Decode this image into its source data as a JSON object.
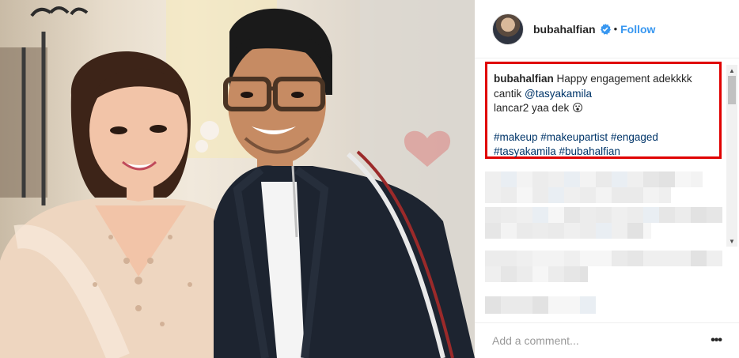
{
  "post": {
    "photo_icon": "photo-of-couple",
    "header": {
      "username": "bubahalfian",
      "verified_icon": "verified-badge-icon",
      "separator": "•",
      "follow_label": "Follow"
    },
    "caption": {
      "username": "bubahalfian",
      "line1": "Happy engagement adekkkk",
      "line2_prefix": "cantik ",
      "mention": "@tasyakamila",
      "line3": "lancar2 yaa dek 😮",
      "hashtags_line1": "#makeup #makeupartist #engaged",
      "hashtags_line2": "#tasyakamila #bubahalfian"
    },
    "comment_box": {
      "placeholder": "Add a comment...",
      "more_icon": "more-options-icon",
      "more_glyph": "•••"
    },
    "colors": {
      "highlight_border": "#e00000",
      "follow_blue": "#3897f0",
      "link_blue": "#003569"
    }
  }
}
